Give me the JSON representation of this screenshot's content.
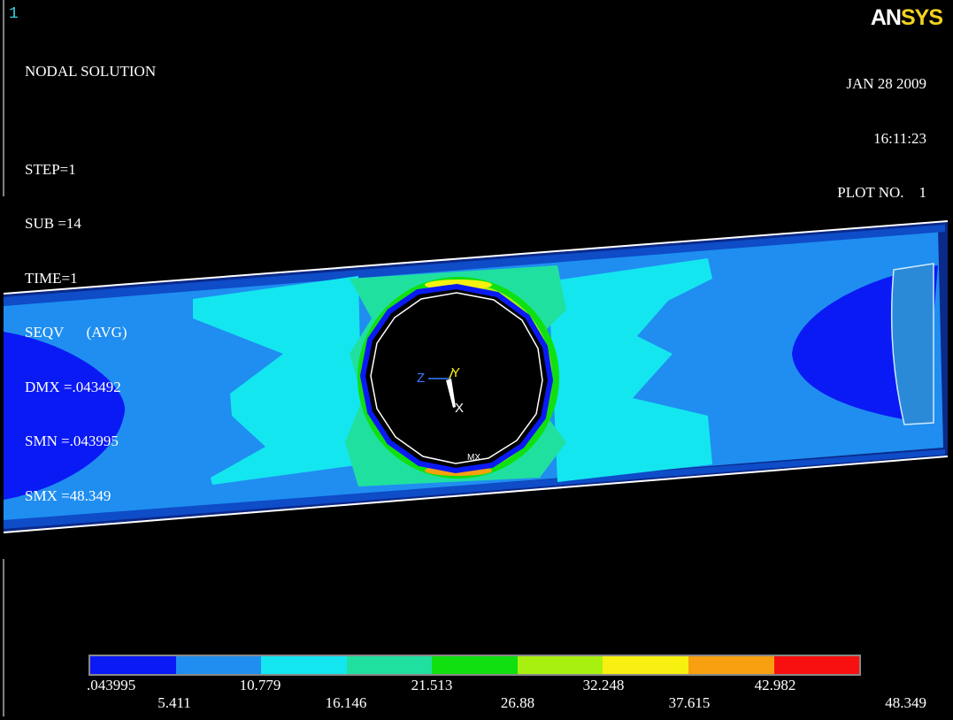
{
  "window_number": "1",
  "info": {
    "lines": [
      "NODAL SOLUTION",
      "",
      "STEP=1",
      "SUB =14",
      "TIME=1",
      "SEQV      (AVG)",
      "DMX =.043492",
      "SMN =.043995",
      "SMX =48.349"
    ]
  },
  "logo": {
    "part1": "AN",
    "part2": "SYS"
  },
  "stamp": {
    "date": "JAN 28 2009",
    "time": "16:11:23",
    "plot": "PLOT NO.    1"
  },
  "triad": {
    "x_label": "X",
    "y_label": "Y",
    "z_label": "Z"
  },
  "markers": {
    "max_label": "MX"
  },
  "legend": {
    "colors": [
      "#0a1af5",
      "#1f8ef0",
      "#14e6f0",
      "#20e0a0",
      "#10e010",
      "#a8f010",
      "#f8f010",
      "#f8a010",
      "#f81010"
    ],
    "labels_top": [
      ".043995",
      "10.779",
      "21.513",
      "32.248",
      "42.982"
    ],
    "labels_bottom": [
      "5.411",
      "16.146",
      "26.88",
      "37.615",
      "48.349"
    ]
  }
}
